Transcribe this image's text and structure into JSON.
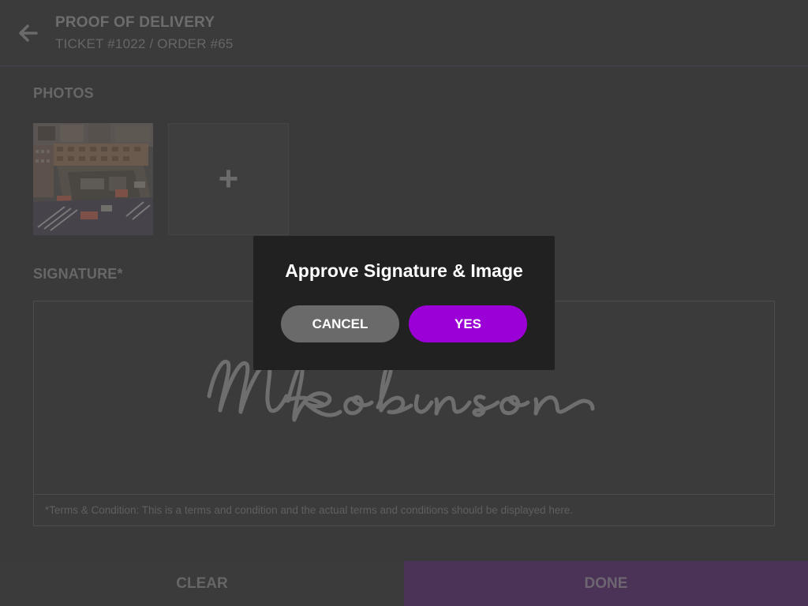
{
  "header": {
    "back_icon": "arrow-left-icon",
    "title": "PROOF OF DELIVERY",
    "subtitle": "TICKET #1022 / ORDER #65"
  },
  "photos": {
    "label": "PHOTOS",
    "add_icon_glyph": "+",
    "add_icon": "plus-icon"
  },
  "signature": {
    "label": "SIGNATURE*",
    "terms": "*Terms & Condition: This is a terms and condition and the actual terms and conditions should be displayed here."
  },
  "footer": {
    "clear_label": "CLEAR",
    "done_label": "DONE"
  },
  "modal": {
    "title": "Approve Signature & Image",
    "cancel_label": "CANCEL",
    "yes_label": "YES"
  },
  "colors": {
    "accent": "#9b00d6",
    "done_dimmed": "#4b3357",
    "modal_bg": "#212121",
    "overlay_bg": "#3a3a3a"
  }
}
